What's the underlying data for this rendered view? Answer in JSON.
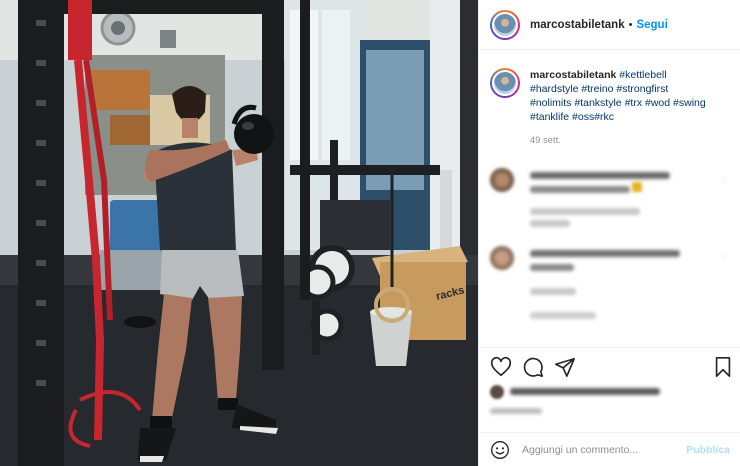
{
  "post": {
    "username": "marcostabiletank",
    "follow_label": "Segui",
    "separator": "•",
    "caption": {
      "username": "marcostabiletank",
      "hashtags": [
        "#kettlebell",
        "#hardstyle",
        "#treino",
        "#strongfirst",
        "#nolimits",
        "#tankstyle",
        "#trx",
        "#wod",
        "#swing",
        "#tanklife",
        "#oss",
        "#rkc"
      ],
      "time_ago": "49 sett."
    },
    "icons": {
      "like": "heart-icon",
      "comment": "comment-bubble-icon",
      "share": "paper-plane-icon",
      "save": "bookmark-icon",
      "emoji": "smiley-icon"
    },
    "comment_input": {
      "placeholder": "Aggiungi un commento...",
      "submit_label": "Pubblica"
    },
    "colors": {
      "link_blue": "#0095f6",
      "hashtag_blue": "#00376b",
      "publish_disabled": "#b2dffc",
      "muted_gray": "#8e8e8e",
      "band_red": "#c8262f"
    }
  }
}
